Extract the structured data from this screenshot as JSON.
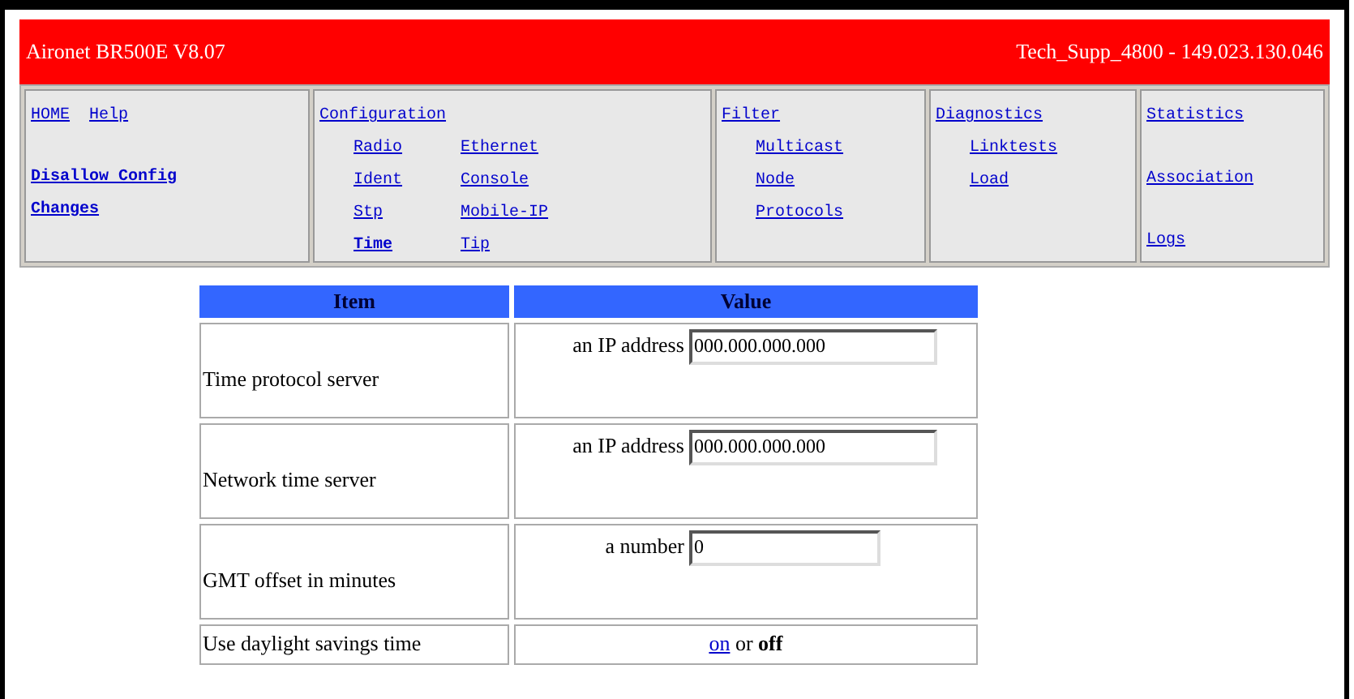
{
  "title_bar": {
    "product": "Aironet BR500E V8.07",
    "device": "Tech_Supp_4800 - 149.023.130.046"
  },
  "nav": {
    "top_links": [
      "HOME",
      "Help"
    ],
    "action": "Disallow Config Changes",
    "sections": [
      {
        "title": "Configuration",
        "items": [
          {
            "label": "Radio",
            "selected": false
          },
          {
            "label": "Ident",
            "selected": false
          },
          {
            "label": "Stp",
            "selected": false
          },
          {
            "label": "Time",
            "selected": true
          },
          {
            "label": "Ethernet",
            "selected": false
          },
          {
            "label": "Console",
            "selected": false
          },
          {
            "label": "Mobile-IP",
            "selected": false
          },
          {
            "label": "Tip",
            "selected": false
          }
        ]
      },
      {
        "title": "Filter",
        "items": [
          {
            "label": "Multicast",
            "selected": false
          },
          {
            "label": "Node",
            "selected": false
          },
          {
            "label": "Protocols",
            "selected": false
          }
        ]
      },
      {
        "title": "Diagnostics",
        "items": [
          {
            "label": "Linktests",
            "selected": false
          },
          {
            "label": "Load",
            "selected": false
          }
        ]
      },
      {
        "title": "Statistics",
        "items": [
          {
            "label": "Association",
            "selected": false
          },
          {
            "label": "Logs",
            "selected": false
          }
        ]
      }
    ]
  },
  "table": {
    "columns": [
      "Item",
      "Value"
    ],
    "rows": [
      {
        "kind": "field",
        "item": "Time protocol server",
        "hint": "an IP address",
        "value": "000.000.000.000"
      },
      {
        "kind": "field",
        "item": "Network time server",
        "hint": "an IP address",
        "value": "000.000.000.000"
      },
      {
        "kind": "field",
        "item": "GMT offset in minutes",
        "hint": "a number",
        "value": "0"
      },
      {
        "kind": "choice",
        "item": "Use daylight savings time",
        "options": [
          {
            "label": "on",
            "selected": false
          },
          {
            "label": "off",
            "selected": true
          }
        ],
        "separator": "or"
      }
    ]
  }
}
